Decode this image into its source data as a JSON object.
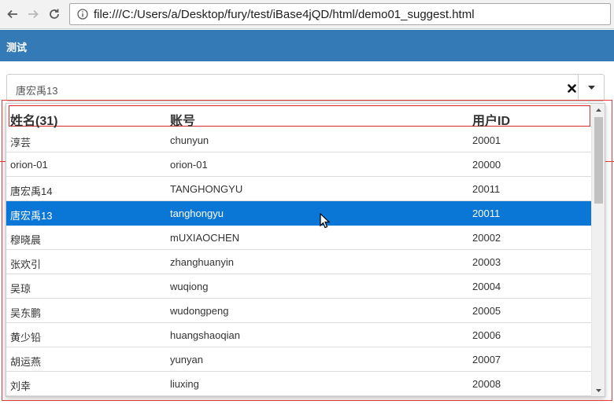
{
  "browser": {
    "url": "file:///C:/Users/a/Desktop/fury/test/iBase4jQD/html/demo01_suggest.html"
  },
  "header": {
    "title": "测试"
  },
  "suggest": {
    "value": "唐宏禹13"
  },
  "table": {
    "columns": [
      "姓名(31)",
      "账号",
      "用户ID"
    ],
    "rows": [
      {
        "name": "淳芸",
        "account": "chunyun",
        "id": "20001",
        "selected": false
      },
      {
        "name": "orion-01",
        "account": "orion-01",
        "id": "20000",
        "selected": false
      },
      {
        "name": "唐宏禹14",
        "account": "TANGHONGYU",
        "id": "20011",
        "selected": false
      },
      {
        "name": "唐宏禹13",
        "account": "tanghongyu",
        "id": "20011",
        "selected": true
      },
      {
        "name": "穆晓晨",
        "account": "mUXIAOCHEN",
        "id": "20002",
        "selected": false
      },
      {
        "name": "张欢引",
        "account": "zhanghuanyin",
        "id": "20003",
        "selected": false
      },
      {
        "name": "吴琼",
        "account": "wuqiong",
        "id": "20004",
        "selected": false
      },
      {
        "name": "吴东鹏",
        "account": "wudongpeng",
        "id": "20005",
        "selected": false
      },
      {
        "name": "黄少铅",
        "account": "huangshaoqian",
        "id": "20006",
        "selected": false
      },
      {
        "name": "胡运燕",
        "account": "yunyan",
        "id": "20007",
        "selected": false
      },
      {
        "name": "刘幸",
        "account": "liuxing",
        "id": "20008",
        "selected": false
      }
    ]
  },
  "colors": {
    "header_bg": "#337ab7",
    "selected_row": "#0a76d6",
    "highlight_border": "#e83a3a"
  },
  "icons": {
    "back": "arrow-left-icon",
    "forward": "arrow-right-icon",
    "reload": "reload-icon",
    "info": "info-icon",
    "clear": "close-icon",
    "dropdown": "caret-down-icon"
  }
}
